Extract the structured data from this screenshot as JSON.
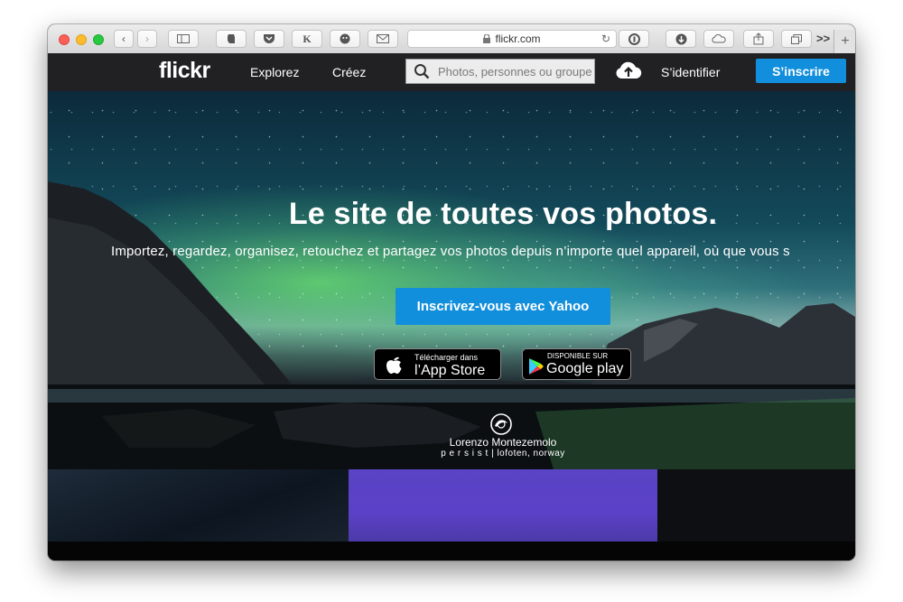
{
  "browser": {
    "url": "flickr.com",
    "more_label": ">>",
    "new_tab_label": "+",
    "extension_k": "K",
    "colors": {
      "close": "#fc5f57",
      "minimize": "#fdbc2e",
      "maximize": "#28c840"
    }
  },
  "nav": {
    "logo": "flickr",
    "explore": "Explorez",
    "create": "Créez",
    "search_placeholder": "Photos, personnes ou groupes",
    "signin": "S’identifier",
    "signup": "S’inscrire"
  },
  "hero": {
    "headline": "Le site de toutes vos photos.",
    "subline": "Importez, regardez, organisez, retouchez et partagez vos photos depuis n’importe quel appareil, où que vous s",
    "cta": "Inscrivez-vous avec Yahoo",
    "app_store_small": "Télécharger dans",
    "app_store_big": "l’App Store",
    "google_small": "DISPONIBLE SUR",
    "google_big": "Google play",
    "credit_name": "Lorenzo Montezemolo",
    "credit_subtitle": "p e r s i s t | lofoten, norway"
  },
  "colors": {
    "accent": "#128fdc",
    "nav_bg": "#212124"
  }
}
